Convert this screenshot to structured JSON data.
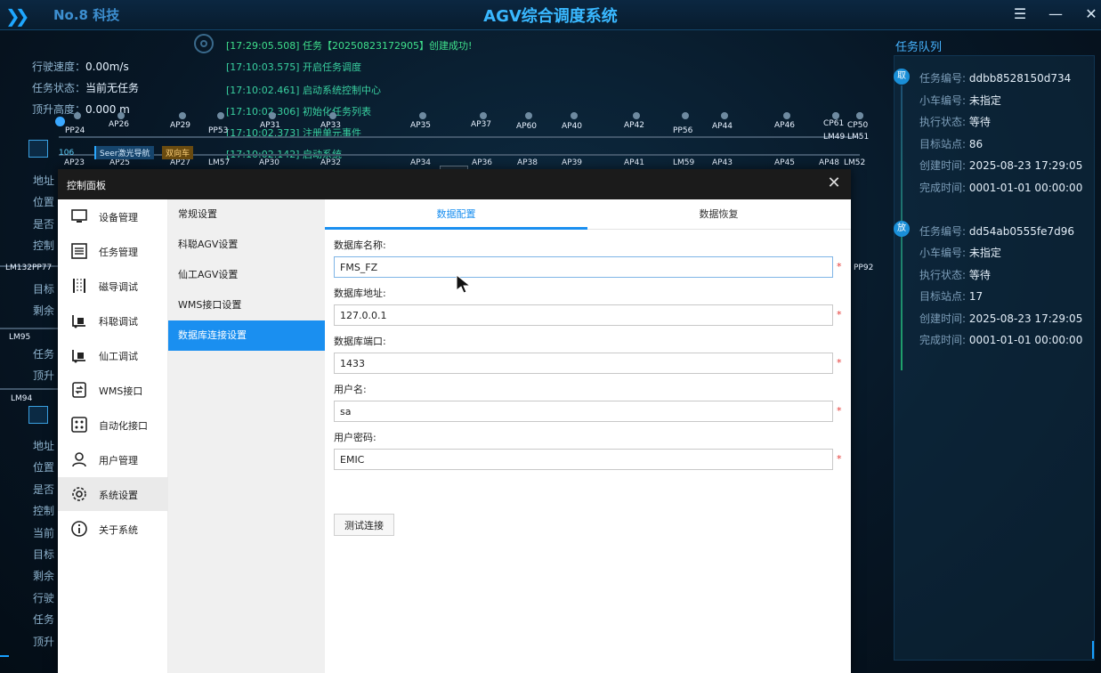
{
  "window": {
    "brand": "No.8 科技",
    "title": "AGV综合调度系统"
  },
  "vehicle_info": {
    "speed_label": "行驶速度：",
    "speed_value": "0.00m/s",
    "status_label": "任务状态：",
    "status_value": "当前无任务",
    "lift_label": "顶升高度：",
    "lift_value": "0.000 m"
  },
  "log": [
    "[17:29:05.508]  任务【20250823172905】创建成功!",
    "[17:10:03.575]  开启任务调度",
    "[17:10:02.461]  启动系统控制中心",
    "[17:10:02.306]  初始化任务列表",
    "[17:10:02.373]  注册单元事件",
    "[17:10:02.142]  启动系统"
  ],
  "map": {
    "top_labels": [
      "PP24",
      "AP26",
      "AP29",
      "PP53",
      "AP31",
      "AP33",
      "AP35",
      "AP37",
      "AP60",
      "AP40",
      "AP42",
      "PP56",
      "AP44",
      "AP46",
      "CP61",
      "CP50",
      "LM49",
      "LM51"
    ],
    "bottom_labels": [
      "AP23",
      "AP25",
      "AP27",
      "LM57",
      "AP30",
      "AP32",
      "AP34",
      "AP36",
      "AP38",
      "AP39",
      "AP41",
      "LM59",
      "AP43",
      "AP45",
      "AP48",
      "LM52"
    ],
    "side_labels": [
      "LM132PP77",
      "LM95",
      "LM94",
      "PP92"
    ],
    "agv_id": "106",
    "nav_tag": "Seer激光导航",
    "dir_tag": "双向车"
  },
  "left_partial_labels": [
    "地址",
    "位置",
    "是否",
    "控制",
    "目标",
    "剩余",
    "任务",
    "顶升",
    "地址",
    "位置",
    "是否",
    "控制",
    "当前",
    "目标",
    "剩余",
    "行驶",
    "任务",
    "顶升"
  ],
  "queue": {
    "title": "任务队列",
    "tasks": [
      {
        "badge": "取",
        "id_label": "任务编号:",
        "id": "ddbb8528150d734",
        "car_label": "小车编号:",
        "car": "未指定",
        "state_label": "执行状态:",
        "state": "等待",
        "target_label": "目标站点:",
        "target": "86",
        "created_label": "创建时间:",
        "created": "2025-08-23 17:29:05",
        "done_label": "完成时间:",
        "done": "0001-01-01 00:00:00"
      },
      {
        "badge": "放",
        "id_label": "任务编号:",
        "id": "dd54ab0555fe7d96",
        "car_label": "小车编号:",
        "car": "未指定",
        "state_label": "执行状态:",
        "state": "等待",
        "target_label": "目标站点:",
        "target": "17",
        "created_label": "创建时间:",
        "created": "2025-08-23 17:29:05",
        "done_label": "完成时间:",
        "done": "0001-01-01 00:00:00"
      }
    ]
  },
  "dialog": {
    "title": "控制面板",
    "main_nav": [
      {
        "label": "设备管理",
        "icon": "monitor-icon"
      },
      {
        "label": "任务管理",
        "icon": "task-list-icon"
      },
      {
        "label": "磁导调试",
        "icon": "magnetic-guide-icon"
      },
      {
        "label": "科聪调试",
        "icon": "forklift-icon"
      },
      {
        "label": "仙工调试",
        "icon": "forklift-icon"
      },
      {
        "label": "WMS接口",
        "icon": "interface-icon"
      },
      {
        "label": "自动化接口",
        "icon": "automation-icon"
      },
      {
        "label": "用户管理",
        "icon": "user-icon"
      },
      {
        "label": "系统设置",
        "icon": "gear-icon"
      },
      {
        "label": "关于系统",
        "icon": "info-icon"
      }
    ],
    "sub_nav": [
      "常规设置",
      "科聪AGV设置",
      "仙工AGV设置",
      "WMS接口设置",
      "数据库连接设置"
    ],
    "tabs": [
      "数据配置",
      "数据恢复"
    ],
    "fields": [
      {
        "label": "数据库名称:",
        "value": "FMS_FZ"
      },
      {
        "label": "数据库地址:",
        "value": "127.0.0.1"
      },
      {
        "label": "数据库端口:",
        "value": "1433"
      },
      {
        "label": "用户名:",
        "value": "sa"
      },
      {
        "label": "用户密码:",
        "value": "EMIC"
      }
    ],
    "required_mark": "*",
    "test_button": "测试连接",
    "close": "✕"
  },
  "colors": {
    "accent": "#1a8ff0",
    "title": "#39b8ff",
    "log": "#39d0a0"
  }
}
